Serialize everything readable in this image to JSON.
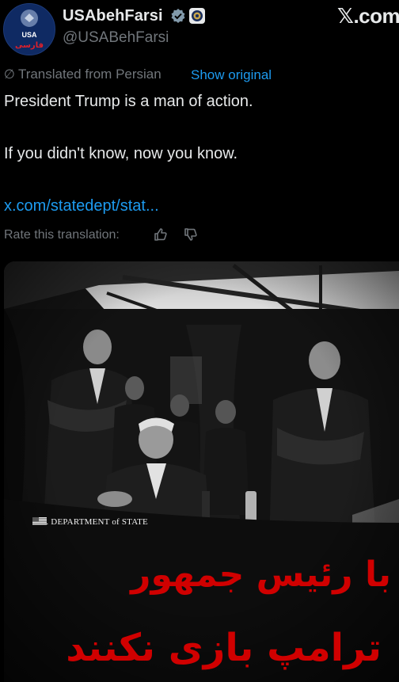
{
  "header": {
    "name": "USAbehFarsi",
    "handle": "@USABehFarsi",
    "platform_logo": "𝕏.com",
    "avatar_text": "USA",
    "avatar_subtext": "فارسی",
    "verified_icon": "verified-check-icon",
    "affiliate_icon": "state-seal-icon"
  },
  "translation": {
    "note": "Translated from Persian",
    "show_original": "Show original",
    "rate_label": "Rate this translation:"
  },
  "tweet": {
    "line1": "President Trump is a man of action.",
    "line2": "If you didn't know, now you know.",
    "link": "x.com/statedept/stat..."
  },
  "media": {
    "caption": "U.S. DEPARTMENT of STATE",
    "overlay_line1": "با رئیس جمهور",
    "overlay_line2": "ترامپ بازی نکنند"
  },
  "colors": {
    "background": "#000000",
    "text": "#e7e9ea",
    "muted": "#71767b",
    "link": "#1d9bf0",
    "overlay_text": "#d00000"
  }
}
